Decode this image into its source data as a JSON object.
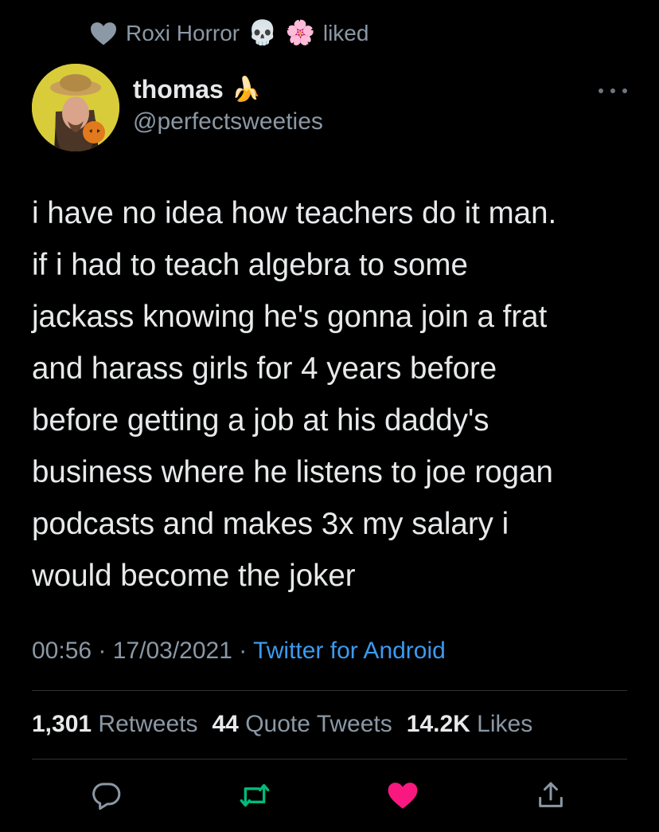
{
  "social_context": {
    "name": "Roxi Horror",
    "emoji_1": "💀",
    "emoji_2": "🌸",
    "action": "liked"
  },
  "tweet": {
    "display_name": "thomas",
    "name_emoji": "🍌",
    "handle": "@perfectsweeties",
    "text_lines": [
      "i have no idea how teachers do it man.",
      "if i had to teach algebra to some",
      "jackass knowing he's gonna join a frat",
      "and harass girls for 4 years before",
      "before getting a job at his daddy's",
      "business where he listens to joe rogan",
      "podcasts and makes 3x my salary i",
      "would become the joker"
    ],
    "time": "00:56",
    "date": "17/03/2021",
    "separator": "·",
    "source": "Twitter for Android"
  },
  "stats": {
    "retweets_count": "1,301",
    "retweets_label": "Retweets",
    "quotes_count": "44",
    "quotes_label": "Quote Tweets",
    "likes_count": "14.2K",
    "likes_label": "Likes"
  },
  "icons": {
    "reply": "reply-icon",
    "retweet": "retweet-icon",
    "like": "heart-icon",
    "share": "share-icon",
    "more": "more-icon"
  },
  "colors": {
    "background": "#000000",
    "text_primary": "#e7e9ea",
    "text_secondary": "#8b98a5",
    "link": "#3b9bf0",
    "retweet_green": "#00ba7c",
    "like_pink": "#f91880"
  }
}
